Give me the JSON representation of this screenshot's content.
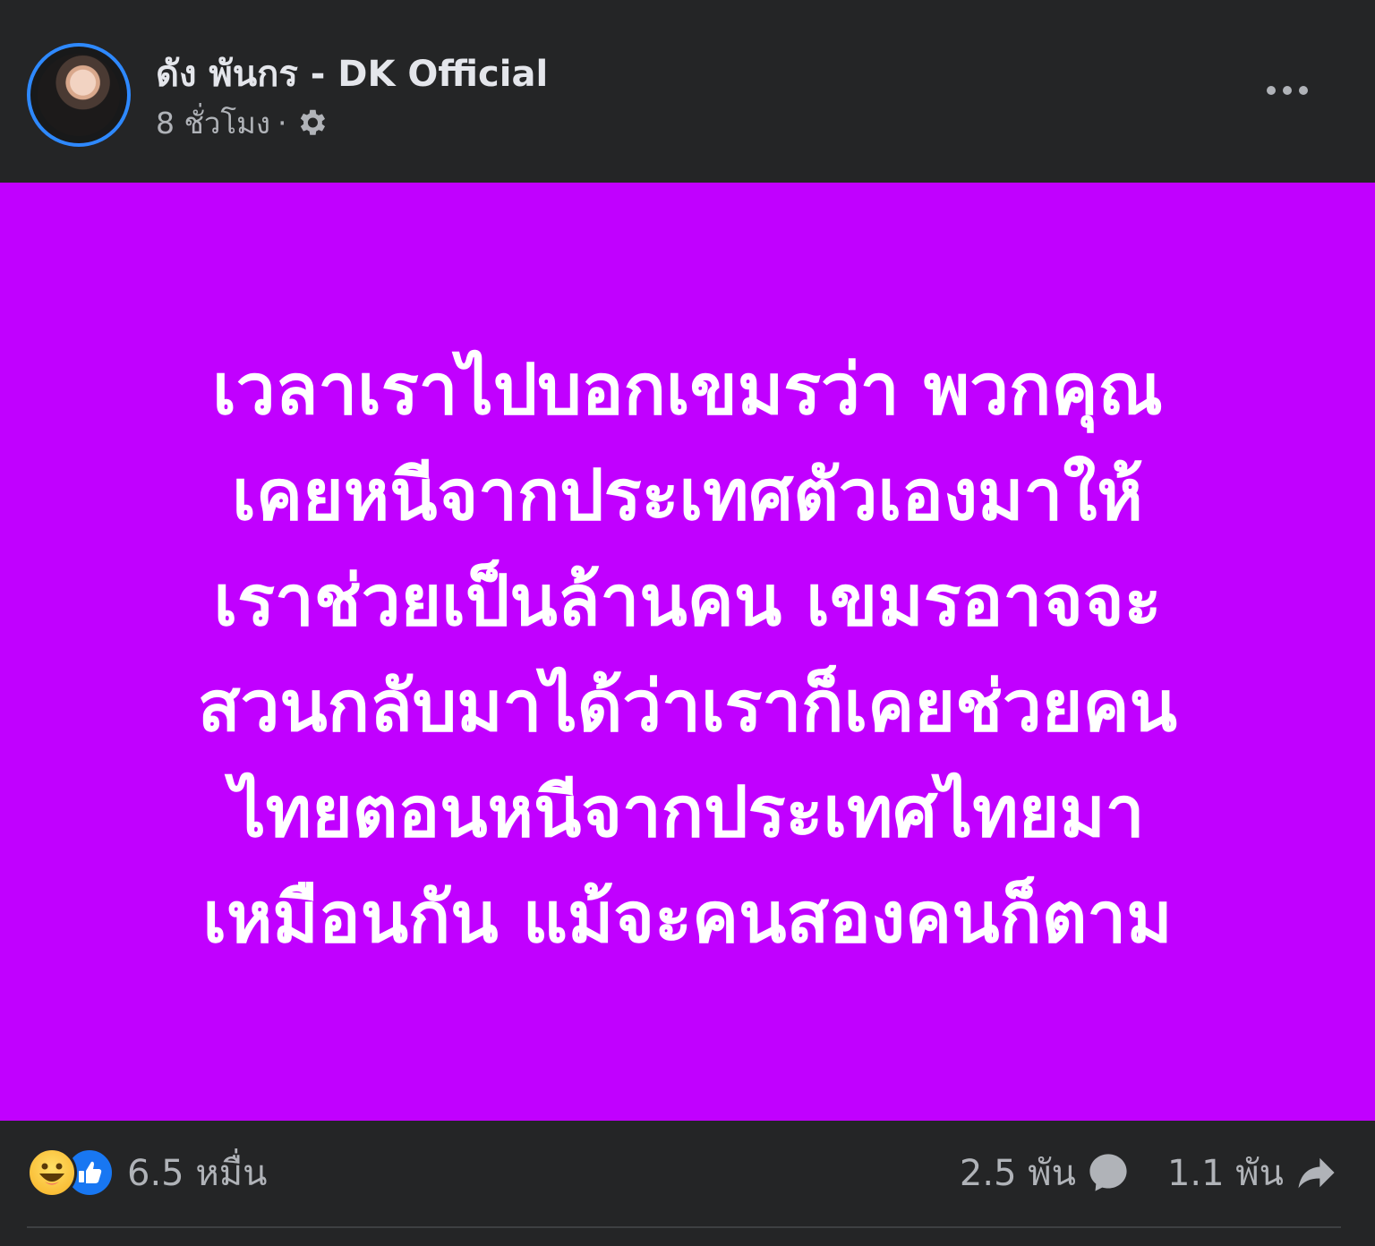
{
  "post": {
    "author": "ดัง พันกร - DK Official",
    "time": "8 ชั่วโมง",
    "separator": "·",
    "privacy_icon": "gear-icon",
    "more_icon": "more-options-icon",
    "background_color": "#c100ff",
    "text_lines": [
      "เวลาเราไปบอกเขมรว่า พวกคุณ",
      "เคยหนีจากประเทศตัวเองมาให้",
      "เราช่วยเป็นล้านคน เขมรอาจจะ",
      "สวนกลับมาได้ว่าเราก็เคยช่วยคน",
      "ไทยตอนหนีจากประเทศไทยมา",
      "เหมือนกัน แม้จะคนสองคนก็ตาม"
    ]
  },
  "footer": {
    "reaction_icons": [
      "haha-reaction-icon",
      "like-reaction-icon"
    ],
    "reactions_count": "6.5 หมื่น",
    "comments_count": "2.5 พัน",
    "comments_icon": "comment-icon",
    "shares_count": "1.1 พัน",
    "shares_icon": "share-icon"
  }
}
